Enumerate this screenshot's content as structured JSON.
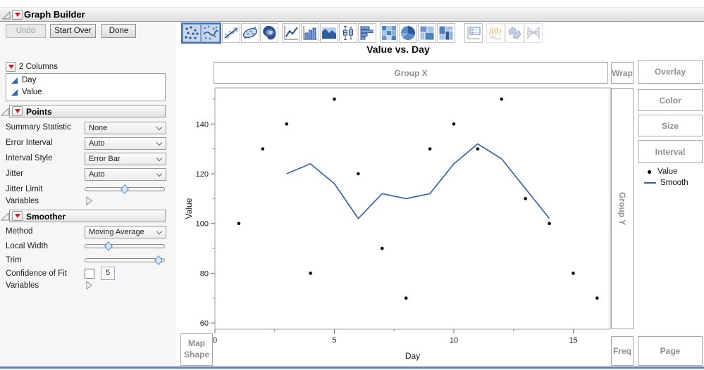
{
  "header": {
    "title": "Graph Builder"
  },
  "buttons": {
    "undo": "Undo",
    "start_over": "Start Over",
    "done": "Done"
  },
  "columns_panel": {
    "title": "2 Columns",
    "items": [
      "Day",
      "Value"
    ]
  },
  "points_panel": {
    "title": "Points",
    "summary_statistic": {
      "label": "Summary Statistic",
      "value": "None"
    },
    "error_interval": {
      "label": "Error Interval",
      "value": "Auto"
    },
    "interval_style": {
      "label": "Interval Style",
      "value": "Error Bar"
    },
    "jitter": {
      "label": "Jitter",
      "value": "Auto"
    },
    "jitter_limit": {
      "label": "Jitter Limit"
    },
    "variables": {
      "label": "Variables"
    }
  },
  "smoother_panel": {
    "title": "Smoother",
    "method": {
      "label": "Method",
      "value": "Moving Average"
    },
    "local_width": {
      "label": "Local Width"
    },
    "trim": {
      "label": "Trim"
    },
    "confidence_of_fit": {
      "label": "Confidence of Fit",
      "checked": false,
      "value": "5"
    },
    "variables": {
      "label": "Variables"
    }
  },
  "sliders": {
    "jitter_limit": 0.5,
    "local_width": 0.27,
    "trim": 0.97
  },
  "toolbar": {
    "groups": [
      [
        {
          "name": "points",
          "selected": true
        },
        {
          "name": "smoother",
          "selected": true
        },
        {
          "name": "line-of-fit"
        },
        {
          "name": "ellipse"
        },
        {
          "name": "contour"
        }
      ],
      [
        {
          "name": "line"
        },
        {
          "name": "bar"
        },
        {
          "name": "area"
        },
        {
          "name": "box-plot"
        },
        {
          "name": "histogram"
        }
      ],
      [
        {
          "name": "heatmap"
        },
        {
          "name": "pie"
        },
        {
          "name": "mosaic"
        },
        {
          "name": "treemap"
        }
      ],
      [
        {
          "name": "caption-box"
        }
      ],
      [
        {
          "name": "formula",
          "disabled": true
        },
        {
          "name": "map-shapes",
          "disabled": true
        },
        {
          "name": "parallel",
          "disabled": true
        }
      ]
    ],
    "group_gaps": [
      0,
      5,
      5,
      13,
      5
    ]
  },
  "zones": {
    "group_x": "Group X",
    "group_y": "Group Y",
    "wrap": "Wrap",
    "overlay": "Overlay",
    "color": "Color",
    "size": "Size",
    "interval": "Interval",
    "map_shape": "Map\nShape",
    "freq": "Freq",
    "page": "Page"
  },
  "legend": [
    {
      "label": "Value",
      "marker": "dot",
      "color": "#000000"
    },
    {
      "label": "Smooth",
      "marker": "line",
      "color": "#3a63ab"
    }
  ],
  "colors": {
    "smooth_line": "#3a63ab",
    "point": "#000000",
    "column_icon": "#3668b0",
    "selected_icon_border": "#4273b8",
    "selected_icon_bg": "#b9cfe8",
    "zone_text": "#8f8f8f",
    "bottom_bar": "#5585c2",
    "red_triangle": "#cd2026"
  },
  "chart_data": {
    "type": "scatter",
    "title": "Value vs. Day",
    "xlabel": "Day",
    "ylabel": "Value",
    "xlim": [
      0,
      16.55
    ],
    "ylim": [
      57.5,
      154.5
    ],
    "x_ticks_major": [
      0,
      5,
      10,
      15
    ],
    "x_ticks_minor": [
      2.5,
      7.5,
      12.5
    ],
    "y_ticks_major": [
      60,
      80,
      100,
      120,
      140
    ],
    "y_ticks_minor": [
      70,
      90,
      110,
      130,
      150
    ],
    "grid": false,
    "legend_position": "right",
    "series": [
      {
        "name": "Value",
        "type": "scatter",
        "color": "#000000",
        "x": [
          1,
          2,
          3,
          4,
          5,
          6,
          7,
          8,
          9,
          10,
          11,
          12,
          13,
          14,
          15,
          16
        ],
        "y": [
          100,
          130,
          140,
          80,
          150,
          120,
          90,
          70,
          130,
          140,
          130,
          150,
          110,
          100,
          80,
          70
        ]
      },
      {
        "name": "Smooth",
        "type": "line",
        "color": "#3a63ab",
        "x": [
          3,
          4,
          5,
          6,
          7,
          8,
          9,
          10,
          11,
          12,
          13,
          14
        ],
        "y": [
          120,
          124,
          116,
          102,
          112,
          110,
          112,
          124,
          132,
          126,
          114,
          102
        ]
      }
    ]
  }
}
